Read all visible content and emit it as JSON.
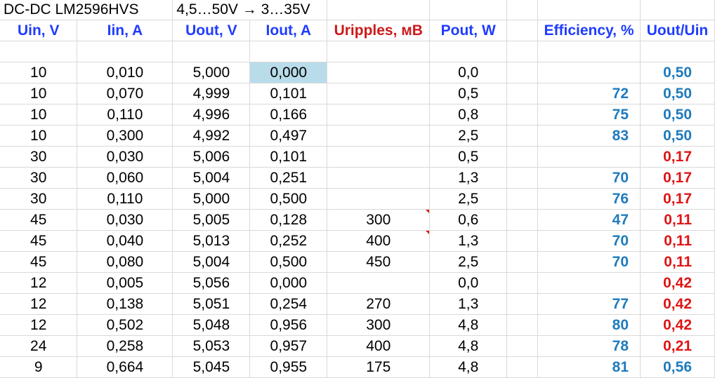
{
  "sheet": {
    "title": "DC-DC LM2596HVS",
    "range": "4,5…50V → 3…35V",
    "headers": [
      "Uin, V",
      "Iin, A",
      "Uout, V",
      "Iout, A",
      "Uripples, мВ",
      "Pout, W",
      "",
      "Efficiency, %",
      "Uout/Uin"
    ],
    "rows": [
      {
        "uin": "10",
        "iin": "0,010",
        "uout": "5,000",
        "iout": "0,000",
        "urip": "",
        "pout": "0,0",
        "eff": "",
        "ratio": "0,50",
        "ratio_color": "blue"
      },
      {
        "uin": "10",
        "iin": "0,070",
        "uout": "4,999",
        "iout": "0,101",
        "urip": "",
        "pout": "0,5",
        "eff": "72",
        "ratio": "0,50",
        "ratio_color": "blue"
      },
      {
        "uin": "10",
        "iin": "0,110",
        "uout": "4,996",
        "iout": "0,166",
        "urip": "",
        "pout": "0,8",
        "eff": "75",
        "ratio": "0,50",
        "ratio_color": "blue"
      },
      {
        "uin": "10",
        "iin": "0,300",
        "uout": "4,992",
        "iout": "0,497",
        "urip": "",
        "pout": "2,5",
        "eff": "83",
        "ratio": "0,50",
        "ratio_color": "blue"
      },
      {
        "uin": "30",
        "iin": "0,030",
        "uout": "5,006",
        "iout": "0,101",
        "urip": "",
        "pout": "0,5",
        "eff": "",
        "ratio": "0,17",
        "ratio_color": "red"
      },
      {
        "uin": "30",
        "iin": "0,060",
        "uout": "5,004",
        "iout": "0,251",
        "urip": "",
        "pout": "1,3",
        "eff": "70",
        "ratio": "0,17",
        "ratio_color": "red"
      },
      {
        "uin": "30",
        "iin": "0,110",
        "uout": "5,000",
        "iout": "0,500",
        "urip": "",
        "pout": "2,5",
        "eff": "76",
        "ratio": "0,17",
        "ratio_color": "red"
      },
      {
        "uin": "45",
        "iin": "0,030",
        "uout": "5,005",
        "iout": "0,128",
        "urip": "300",
        "pout": "0,6",
        "eff": "47",
        "ratio": "0,11",
        "ratio_color": "red"
      },
      {
        "uin": "45",
        "iin": "0,040",
        "uout": "5,013",
        "iout": "0,252",
        "urip": "400",
        "pout": "1,3",
        "eff": "70",
        "ratio": "0,11",
        "ratio_color": "red"
      },
      {
        "uin": "45",
        "iin": "0,080",
        "uout": "5,004",
        "iout": "0,500",
        "urip": "450",
        "pout": "2,5",
        "eff": "70",
        "ratio": "0,11",
        "ratio_color": "red"
      },
      {
        "uin": "12",
        "iin": "0,005",
        "uout": "5,056",
        "iout": "0,000",
        "urip": "",
        "pout": "0,0",
        "eff": "",
        "ratio": "0,42",
        "ratio_color": "red"
      },
      {
        "uin": "12",
        "iin": "0,138",
        "uout": "5,051",
        "iout": "0,254",
        "urip": "270",
        "pout": "1,3",
        "eff": "77",
        "ratio": "0,42",
        "ratio_color": "red"
      },
      {
        "uin": "12",
        "iin": "0,502",
        "uout": "5,048",
        "iout": "0,956",
        "urip": "300",
        "pout": "4,8",
        "eff": "80",
        "ratio": "0,42",
        "ratio_color": "red"
      },
      {
        "uin": "24",
        "iin": "0,258",
        "uout": "5,053",
        "iout": "0,957",
        "urip": "400",
        "pout": "4,8",
        "eff": "78",
        "ratio": "0,21",
        "ratio_color": "red"
      },
      {
        "uin": "9",
        "iin": "0,664",
        "uout": "5,045",
        "iout": "0,955",
        "urip": "175",
        "pout": "4,8",
        "eff": "81",
        "ratio": "0,56",
        "ratio_color": "blue"
      }
    ],
    "colors": {
      "header_blue": "#1f3cff",
      "header_red": "#cc1a1a",
      "value_blue": "#1f7bbd",
      "value_red": "#e01414",
      "selection": "#b8dcea",
      "grid": "#d9d9d9"
    }
  }
}
